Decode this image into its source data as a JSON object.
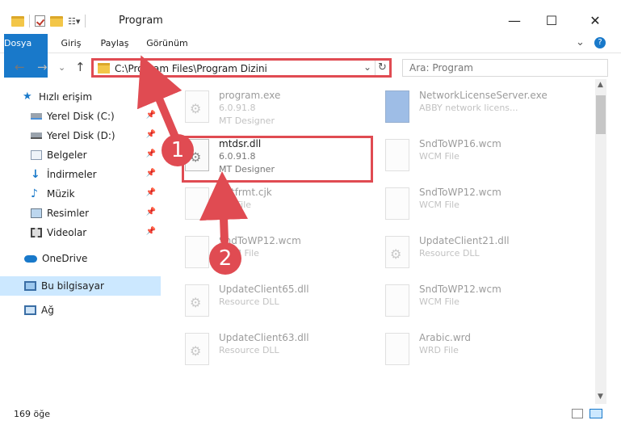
{
  "window": {
    "title": "Program",
    "minimize": "—",
    "maximize": "☐",
    "close": "✕"
  },
  "ribbon": {
    "tabs": [
      "Dosya",
      "Giriş",
      "Paylaş",
      "Görünüm"
    ],
    "expand": "⌄",
    "help": "?"
  },
  "nav": {
    "back": "←",
    "forward": "→",
    "recent": "⌄",
    "up": "↑"
  },
  "address": {
    "path": "C:\\Program Files\\Program Dizini",
    "dropdown": "⌄",
    "refresh": "↻"
  },
  "search": {
    "placeholder": "Ara: Program"
  },
  "sidebar": {
    "items": [
      {
        "label": "Hızlı erişim",
        "icon": "star-icon"
      },
      {
        "label": "Yerel Disk (C:)",
        "icon": "drive-icon",
        "pinned": true
      },
      {
        "label": "Yerel Disk (D:)",
        "icon": "drive-icon",
        "pinned": true
      },
      {
        "label": "Belgeler",
        "icon": "documents-icon",
        "pinned": true
      },
      {
        "label": "İndirmeler",
        "icon": "download-icon",
        "pinned": true
      },
      {
        "label": "Müzik",
        "icon": "music-icon",
        "pinned": true
      },
      {
        "label": "Resimler",
        "icon": "pictures-icon",
        "pinned": true
      },
      {
        "label": "Videolar",
        "icon": "video-icon",
        "pinned": true
      },
      {
        "label": "OneDrive",
        "icon": "cloud-icon"
      },
      {
        "label": "Bu bilgisayar",
        "icon": "computer-icon"
      },
      {
        "label": "Ağ",
        "icon": "network-icon"
      }
    ]
  },
  "files": [
    {
      "name": "program.exe",
      "meta1": "6.0.91.8",
      "meta2": "MT Designer"
    },
    {
      "name": "NetworkLicenseServer.exe",
      "meta1": "ABBY network licens...",
      "meta2": ""
    },
    {
      "name": "mtdsr.dll",
      "meta1": "6.0.91.8",
      "meta2": "MT Designer"
    },
    {
      "name": "SndToWP16.wcm",
      "meta1": "WCM File",
      "meta2": ""
    },
    {
      "name": "netfrmt.cjk",
      "meta1": "CJK File",
      "meta2": ""
    },
    {
      "name": "SndToWP12.wcm",
      "meta1": "WCM File",
      "meta2": ""
    },
    {
      "name": "SndToWP12.wcm",
      "meta1": "WCM File",
      "meta2": ""
    },
    {
      "name": "UpdateClient21.dll",
      "meta1": "Resource DLL",
      "meta2": ""
    },
    {
      "name": "UpdateClient65.dll",
      "meta1": "Resource DLL",
      "meta2": ""
    },
    {
      "name": "SndToWP12.wcm",
      "meta1": "WCM File",
      "meta2": ""
    },
    {
      "name": "UpdateClient63.dll",
      "meta1": "Resource DLL",
      "meta2": ""
    },
    {
      "name": "Arabic.wrd",
      "meta1": "WRD File",
      "meta2": ""
    }
  ],
  "annotations": {
    "badge1": "1",
    "badge2": "2"
  },
  "status": {
    "count": "169 öğe"
  },
  "colors": {
    "accent": "#1979ca",
    "highlight": "#e04b52",
    "selected": "#cce8ff"
  }
}
